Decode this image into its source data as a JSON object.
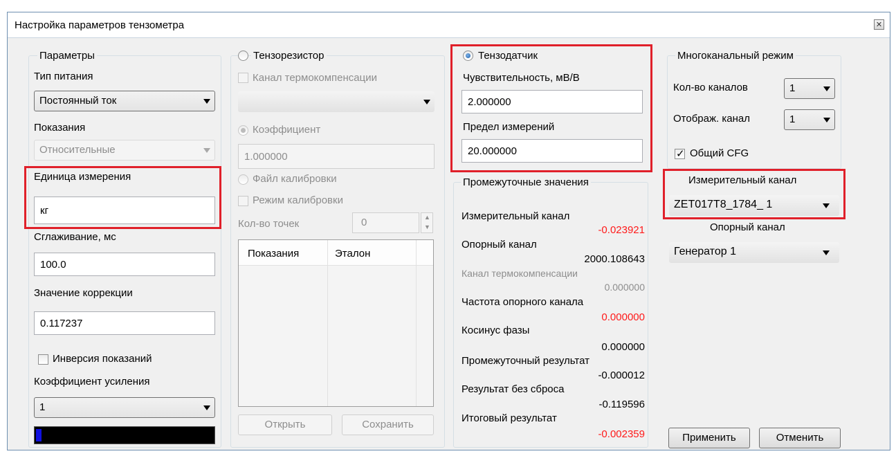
{
  "window": {
    "title": "Настройка параметров тензометра"
  },
  "params": {
    "legend": "Параметры",
    "power_label": "Тип питания",
    "power_value": "Постоянный ток",
    "readings_label": "Показания",
    "readings_value": "Относительные",
    "unit_label": "Единица измерения",
    "unit_value": "кг",
    "smoothing_label": "Сглаживание, мс",
    "smoothing_value": "100.0",
    "correction_label": "Значение коррекции",
    "correction_value": "0.117237",
    "inversion_label": "Инверсия показаний",
    "gain_label": "Коэффициент усиления",
    "gain_value": "1",
    "level_fraction": 0.03
  },
  "tensoresistor": {
    "legend": "Тензорезистор",
    "thermo_label": "Канал термокомпенсации",
    "thermo_value": "",
    "coef_label": "Коэффициент",
    "coef_value": "1.000000",
    "calfile_label": "Файл калибровки",
    "calmode_label": "Режим калибровки",
    "points_label": "Кол-во точек",
    "points_value": "0",
    "table_headers": [
      "Показания",
      "Эталон"
    ],
    "open_label": "Открыть",
    "save_label": "Сохранить"
  },
  "tensosensor": {
    "legend": "Тензодатчик",
    "sensitivity_label": "Чувствительность, мВ/В",
    "sensitivity_value": "2.000000",
    "limit_label": "Предел измерений",
    "limit_value": "20.000000"
  },
  "intermediate": {
    "legend": "Промежуточные значения",
    "meas_label": "Измерительный канал",
    "meas_value": "-0.023921",
    "ref_label": "Опорный канал",
    "ref_value": "2000.108643",
    "thermo_label": "Канал термокомпенсации",
    "thermo_value": "0.000000",
    "freq_label": "Частота опорного канала",
    "freq_value": "0.000000",
    "cos_label": "Косинус фазы",
    "cos_value": "0.000000",
    "inter_label": "Промежуточный результат",
    "inter_value": "-0.000012",
    "nores_label": "Результат без сброса",
    "nores_value": "-0.119596",
    "final_label": "Итоговый результат",
    "final_value": "-0.002359"
  },
  "multichannel": {
    "legend": "Многоканальный режим",
    "count_label": "Кол-во каналов",
    "count_value": "1",
    "display_label": "Отображ. канал",
    "display_value": "1",
    "cfg_label": "Общий CFG",
    "meas_channel_label": "Измерительный канал",
    "meas_channel_value": "ZET017T8_1784_ 1",
    "ref_channel_label": "Опорный канал",
    "ref_channel_value": "Генератор 1"
  },
  "buttons": {
    "apply": "Применить",
    "cancel": "Отменить"
  },
  "colors": {
    "highlight": "#e0202a",
    "negative": "#ff1a1a",
    "accent": "#1d5fa8"
  }
}
